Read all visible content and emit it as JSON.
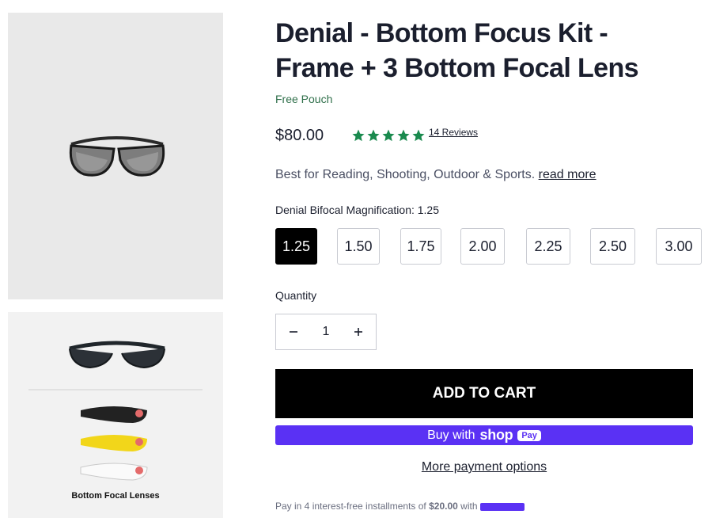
{
  "product": {
    "title": "Denial - Bottom Focus Kit - Frame + 3 Bottom Focal Lens",
    "subtitle": "Free Pouch",
    "price": "$80.00",
    "rating": {
      "value": 5,
      "max": 5,
      "reviews_label": "14 Reviews",
      "star_color": "#1a8a4e"
    },
    "description": "Best for Reading, Shooting, Outdoor & Sports.",
    "read_more": "read more"
  },
  "gallery": {
    "secondary_caption": "Bottom Focal Lenses",
    "lens_colors": [
      "#222222",
      "#f2d61a",
      "#ffffff"
    ]
  },
  "variant": {
    "label": "Denial Bifocal Magnification: 1.25",
    "options": [
      "1.25",
      "1.50",
      "1.75",
      "2.00",
      "2.25",
      "2.50",
      "3.00"
    ],
    "selected": "1.25"
  },
  "quantity": {
    "label": "Quantity",
    "value": "1",
    "minus_icon": "minus-icon",
    "plus_icon": "plus-icon"
  },
  "actions": {
    "add_to_cart": "ADD TO CART",
    "buy_with": "Buy with",
    "shop_logo": "shop",
    "pay_badge": "Pay",
    "more_payment": "More payment options"
  },
  "installments": {
    "text": "Pay in 4 interest-free installments of",
    "amount": "$20.00",
    "with": "with"
  },
  "colors": {
    "accent": "#000000",
    "shop_pay": "#5a31f4",
    "subtitle_green": "#2f6f4a"
  }
}
